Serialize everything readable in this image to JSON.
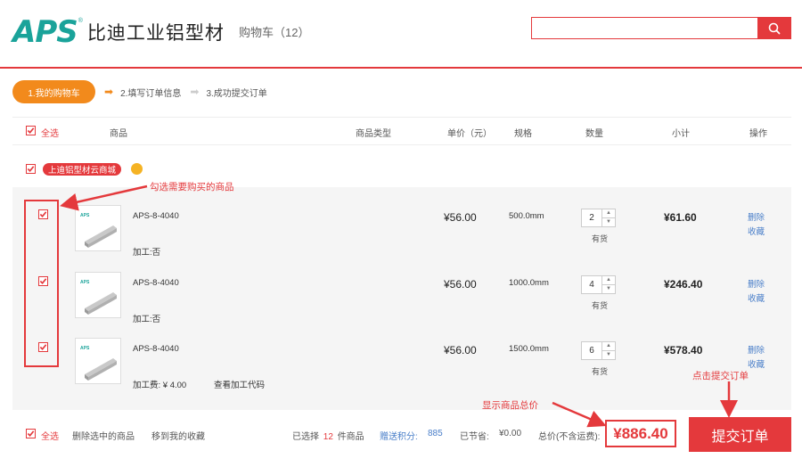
{
  "header": {
    "logo_mark": "APS",
    "logo_reg": "®",
    "logo_name": "比迪工业铝型材",
    "cart_label": "购物车",
    "cart_count": "（12）",
    "search_placeholder": "",
    "search_icon": "search-icon"
  },
  "steps": {
    "current": "1.我的购物车",
    "step2": "2.填写订单信息",
    "step3": "3.成功提交订单",
    "active_color": "#f28a1c"
  },
  "columns": {
    "select_all": "全选",
    "product": "商品",
    "product_type": "商品类型",
    "unit_price": "单价（元）",
    "spec": "规格",
    "quantity": "数量",
    "subtotal": "小计",
    "actions": "操作"
  },
  "shop": {
    "name": "上迪铝型材云商城"
  },
  "items": [
    {
      "name": "APS-8-4040",
      "process": "加工:否",
      "price": "¥56.00",
      "spec": "500.0mm",
      "qty": "2",
      "stock": "有货",
      "subtotal": "¥61.60",
      "delete": "删除",
      "favorite": "收藏"
    },
    {
      "name": "APS-8-4040",
      "process": "加工:否",
      "price": "¥56.00",
      "spec": "1000.0mm",
      "qty": "4",
      "stock": "有货",
      "subtotal": "¥246.40",
      "delete": "删除",
      "favorite": "收藏"
    },
    {
      "name": "APS-8-4040",
      "process": "加工费: ¥ 4.00",
      "price": "¥56.00",
      "spec": "1500.0mm",
      "qty": "6",
      "stock": "有货",
      "subtotal": "¥578.40",
      "delete": "删除",
      "favorite": "收藏",
      "code_link": "查看加工代码"
    }
  ],
  "footer": {
    "select_all": "全选",
    "delete_selected": "删除选中的商品",
    "move_to_favorites": "移到我的收藏",
    "selected_prefix": "已选择",
    "selected_count": "12",
    "selected_suffix": "件商品",
    "points_label": "赠送积分:",
    "points_value": "885",
    "saved_label": "已节省:",
    "saved_value": "¥0.00",
    "total_label": "总价(不含运费):",
    "total_value": "¥886.40",
    "submit": "提交订单"
  },
  "annotations": {
    "select_hint": "勾选需要购买的商品",
    "total_hint": "显示商品总价",
    "submit_hint": "点击提交订单"
  },
  "colors": {
    "brand": "#1aa39a",
    "accent": "#e4393c",
    "link": "#4a7fc9"
  }
}
